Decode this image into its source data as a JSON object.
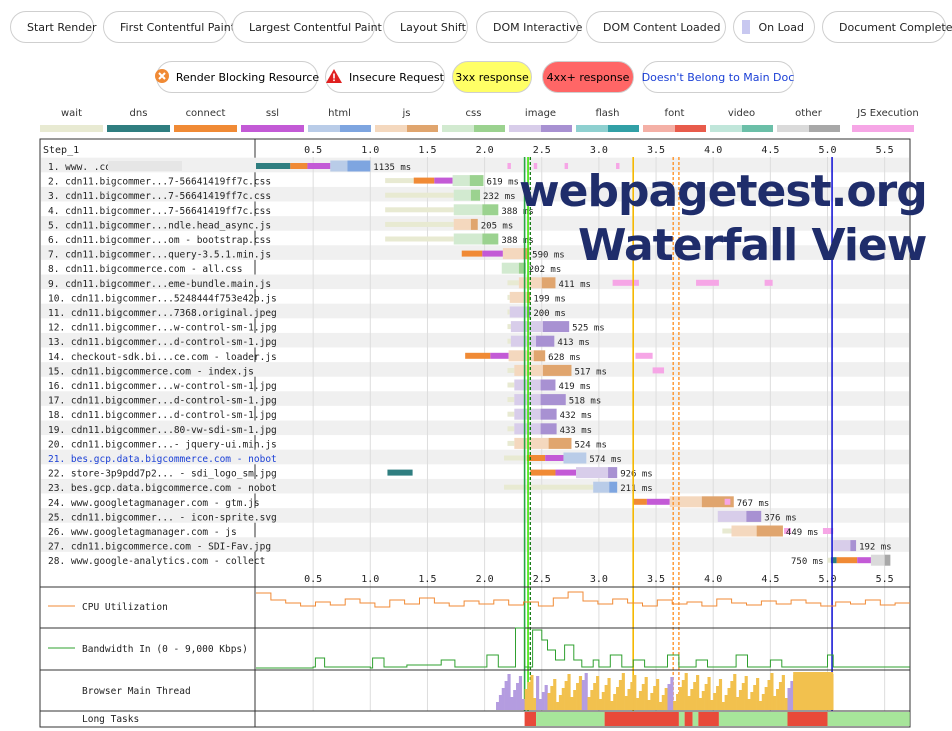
{
  "legend_top": [
    {
      "label": "Start Render",
      "color": "#28a745",
      "style": "solid"
    },
    {
      "label": "First Contentful Paint",
      "color": "#39e600",
      "style": "solid"
    },
    {
      "label": "Largest Contentful Paint",
      "color": "#147a14",
      "style": "dashed"
    },
    {
      "label": "Layout Shift",
      "color": "#ff8c1a",
      "style": "dashed"
    },
    {
      "label": "DOM Interactive",
      "color": "#f5b800",
      "style": "solid"
    },
    {
      "label": "DOM Content Loaded",
      "color": "#d98be0",
      "style": "box"
    },
    {
      "label": "On Load",
      "color": "#c8c8f0",
      "style": "box"
    },
    {
      "label": "Document Complete",
      "color": "#1a1ad6",
      "style": "solid"
    }
  ],
  "legend_bottom": [
    {
      "label": "Render Blocking Resource",
      "kind": "blocking"
    },
    {
      "label": "Insecure Request",
      "kind": "insecure"
    },
    {
      "label": "3xx response",
      "kind": "3xx",
      "bg": "#ffff66"
    },
    {
      "label": "4xx+ response",
      "kind": "4xx",
      "bg": "#ff6666"
    },
    {
      "label": "Doesn't Belong to Main Doc",
      "kind": "foreign",
      "color": "#1a3fd6"
    }
  ],
  "connection_types": [
    {
      "label": "wait",
      "colors": [
        "#e8ead2"
      ]
    },
    {
      "label": "dns",
      "colors": [
        "#2f7e80"
      ]
    },
    {
      "label": "connect",
      "colors": [
        "#f08a35"
      ]
    },
    {
      "label": "ssl",
      "colors": [
        "#c35ad6"
      ]
    },
    {
      "label": "html",
      "colors": [
        "#b9cce8",
        "#7ea5e0"
      ]
    },
    {
      "label": "js",
      "colors": [
        "#f4d8be",
        "#e0a56e"
      ]
    },
    {
      "label": "css",
      "colors": [
        "#d2ead0",
        "#9bd28f"
      ]
    },
    {
      "label": "image",
      "colors": [
        "#d8cdea",
        "#a891d2"
      ]
    },
    {
      "label": "flash",
      "colors": [
        "#8ed0d0",
        "#31a0a6"
      ]
    },
    {
      "label": "font",
      "colors": [
        "#f4b0a6",
        "#e85b4b"
      ]
    },
    {
      "label": "video",
      "colors": [
        "#c0e6da",
        "#6bbfa8"
      ]
    },
    {
      "label": "other",
      "colors": [
        "#dadada",
        "#a8a8a8"
      ]
    },
    {
      "label": "JS Execution",
      "colors": [
        "#f6a6e6"
      ]
    }
  ],
  "overlay": {
    "line1": "webpagetest.org",
    "line2": "Waterfall View"
  },
  "chart_data": {
    "type": "waterfall",
    "step_label": "Step_1",
    "x_unit": "seconds",
    "xlim": [
      0,
      5.7
    ],
    "x_ticks": [
      0.5,
      1.0,
      1.5,
      2.0,
      2.5,
      3.0,
      3.5,
      4.0,
      4.5,
      5.0,
      5.5
    ],
    "x_tick_labels": [
      "0.5",
      "1.0",
      "1.5",
      "2.0",
      "2.5",
      "3.0",
      "3.5",
      "4.0",
      "4.5",
      "5.0",
      "5.5"
    ],
    "events": [
      {
        "name": "Start Render",
        "t": 2.35,
        "color": "#28a745"
      },
      {
        "name": "First Contentful Paint",
        "t": 2.38,
        "color": "#39e600"
      },
      {
        "name": "Largest Contentful Paint",
        "t": 2.4,
        "color": "#147a14",
        "dashed": true
      },
      {
        "name": "DOM Interactive",
        "t": 3.3,
        "color": "#f5b800"
      },
      {
        "name": "Layout Shift",
        "t": 3.65,
        "color": "#ff8c1a",
        "dashed": true
      },
      {
        "name": "Layout Shift",
        "t": 3.7,
        "color": "#ff8c1a",
        "dashed": true
      },
      {
        "name": "Document Complete",
        "t": 5.04,
        "color": "#1a1ad6"
      }
    ],
    "requests": [
      {
        "n": 1,
        "label": "1. www.                    .com - /",
        "type": "html",
        "start": 0,
        "wait": 0,
        "dns": 0.3,
        "connect": 0.15,
        "ssl": 0.2,
        "ttfb": 0.15,
        "download": 0.2,
        "ms": "1135 ms",
        "redact": true
      },
      {
        "n": 2,
        "label": "2. cdn11.bigcommer...7-56641419ff7c.css",
        "type": "css",
        "start": 1.13,
        "wait": 0.25,
        "dns": 0,
        "connect": 0.18,
        "ssl": 0.16,
        "ttfb": 0.15,
        "download": 0.12,
        "ms": "619 ms"
      },
      {
        "n": 3,
        "label": "3. cdn11.bigcommer...7-56641419ff7c.css",
        "type": "css",
        "start": 1.13,
        "wait": 0.6,
        "ttfb": 0.15,
        "download": 0.08,
        "ms": "232 ms"
      },
      {
        "n": 4,
        "label": "4. cdn11.bigcommer...7-56641419ff7c.css",
        "type": "css",
        "start": 1.13,
        "wait": 0.6,
        "ttfb": 0.25,
        "download": 0.14,
        "ms": "388 ms"
      },
      {
        "n": 5,
        "label": "5. cdn11.bigcommer...ndle.head_async.js",
        "type": "js",
        "start": 1.13,
        "wait": 0.6,
        "ttfb": 0.15,
        "download": 0.06,
        "ms": "205 ms"
      },
      {
        "n": 6,
        "label": "6. cdn11.bigcommer...om - bootstrap.css",
        "type": "css",
        "start": 1.13,
        "wait": 0.6,
        "ttfb": 0.25,
        "download": 0.14,
        "ms": "388 ms"
      },
      {
        "n": 7,
        "label": "7. cdn11.bigcommer...query-3.5.1.min.js",
        "type": "js",
        "start": 1.35,
        "wait": 0,
        "connect": 0.18,
        "ssl": 0.18,
        "gap": 0.45,
        "ttfb": 0.18,
        "download": 0.05,
        "ms": "590 ms",
        "dl_mark": 2.37
      },
      {
        "n": 8,
        "label": "8. cdn11.bigcommerce.com - all.css",
        "type": "css",
        "start": 2.15,
        "wait": 0,
        "ttfb": 0.15,
        "download": 0.06,
        "ms": "202 ms"
      },
      {
        "n": 9,
        "label": "9. cdn11.bigcommer...eme-bundle.main.js",
        "type": "js",
        "start": 2.2,
        "wait": 0.1,
        "ttfb": 0.2,
        "download": 0.12,
        "ms": "411 ms",
        "exec": [
          [
            3.12,
            3.35
          ],
          [
            3.85,
            4.05
          ],
          [
            4.45,
            4.52
          ]
        ]
      },
      {
        "n": 10,
        "label": "10. cdn11.bigcommer...5248444f753e42b.js",
        "type": "js",
        "start": 2.2,
        "wait": 0.02,
        "ttfb": 0.15,
        "download": 0.03,
        "ms": "199 ms"
      },
      {
        "n": 11,
        "label": "11. cdn11.bigcommer...7368.original.jpeg",
        "type": "image",
        "start": 2.2,
        "wait": 0.02,
        "ttfb": 0.15,
        "download": 0.03,
        "ms": "200 ms"
      },
      {
        "n": 12,
        "label": "12. cdn11.bigcommer...w-control-sm-1.jpg",
        "type": "image",
        "start": 2.2,
        "wait": 0.03,
        "ttfb": 0.28,
        "download": 0.23,
        "ms": "525 ms"
      },
      {
        "n": 13,
        "label": "13. cdn11.bigcommer...d-control-sm-1.jpg",
        "type": "image",
        "start": 2.2,
        "wait": 0.03,
        "ttfb": 0.22,
        "download": 0.16,
        "ms": "413 ms"
      },
      {
        "n": 14,
        "label": "14. checkout-sdk.bi...ce.com - loader.js",
        "type": "js",
        "start": 1.55,
        "wait": 0,
        "connect": 0.22,
        "ssl": 0.16,
        "gap": 0.28,
        "ttfb": 0.22,
        "download": 0.1,
        "ms": "628 ms",
        "exec": [
          [
            3.32,
            3.47
          ]
        ]
      },
      {
        "n": 15,
        "label": "15. cdn11.bigcommerce.com - index.js",
        "type": "js",
        "start": 2.2,
        "wait": 0.06,
        "ttfb": 0.25,
        "download": 0.25,
        "ms": "517 ms",
        "exec": [
          [
            3.47,
            3.57
          ]
        ]
      },
      {
        "n": 16,
        "label": "16. cdn11.bigcommer...w-control-sm-1.jpg",
        "type": "image",
        "start": 2.2,
        "wait": 0.06,
        "ttfb": 0.23,
        "download": 0.13,
        "ms": "419 ms"
      },
      {
        "n": 17,
        "label": "17. cdn11.bigcommer...d-control-sm-1.jpg",
        "type": "image",
        "start": 2.2,
        "wait": 0.06,
        "ttfb": 0.23,
        "download": 0.22,
        "ms": "518 ms"
      },
      {
        "n": 18,
        "label": "18. cdn11.bigcommer...d-control-sm-1.jpg",
        "type": "image",
        "start": 2.2,
        "wait": 0.06,
        "ttfb": 0.23,
        "download": 0.14,
        "ms": "432 ms"
      },
      {
        "n": 19,
        "label": "19. cdn11.bigcommer...80-vw-sdi-sm-1.jpg",
        "type": "image",
        "start": 2.2,
        "wait": 0.06,
        "ttfb": 0.23,
        "download": 0.14,
        "ms": "433 ms"
      },
      {
        "n": 20,
        "label": "20. cdn11.bigcommer...- jquery-ui.min.js",
        "type": "js",
        "start": 2.2,
        "wait": 0.06,
        "ttfb": 0.3,
        "download": 0.2,
        "ms": "524 ms"
      },
      {
        "n": 21,
        "label": "21. bes.gcp.data.bigcommerce.com - nobot",
        "type": "html",
        "start": 2.17,
        "wait": 0.2,
        "connect": 0.16,
        "ssl": 0.16,
        "ttfb": 0.2,
        "download": 0,
        "ms": "574 ms",
        "foreign": true
      },
      {
        "n": 22,
        "label": "22. store-3p9pdd7p2... - sdi_logo_sm.jpg",
        "type": "image",
        "start": 1.15,
        "wait": 0,
        "dns": 0.22,
        "gap": 1.03,
        "connect": 0.22,
        "ssl": 0.18,
        "ttfb": 0.28,
        "download": 0.08,
        "ms": "926 ms"
      },
      {
        "n": 23,
        "label": "23. bes.gcp.data.bigcommerce.com - nobot",
        "type": "html",
        "start": 2.17,
        "wait": 0.78,
        "ttfb": 0.14,
        "download": 0.07,
        "ms": "211 ms"
      },
      {
        "n": 24,
        "label": "24. www.googletagmanager.com - gtm.js",
        "type": "js",
        "start": 3.3,
        "wait": 0,
        "connect": 0.12,
        "ssl": 0.2,
        "ttfb": 0.28,
        "download": 0.28,
        "ms": "767 ms",
        "exec": [
          [
            4.1,
            4.15
          ]
        ]
      },
      {
        "n": 25,
        "label": "25. cdn11.bigcommer... - icon-sprite.svg",
        "type": "image",
        "start": 4.04,
        "wait": 0,
        "ttfb": 0.25,
        "download": 0.13,
        "ms": "376 ms"
      },
      {
        "n": 26,
        "label": "26. www.googletagmanager.com - js",
        "type": "js",
        "start": 4.08,
        "wait": 0.08,
        "ttfb": 0.22,
        "download": 0.23,
        "ms": "449 ms",
        "exec": [
          [
            4.62,
            4.68
          ],
          [
            4.96,
            5.05
          ]
        ]
      },
      {
        "n": 27,
        "label": "27. cdn11.bigcommerce.com - SDI-Fav.jpg",
        "type": "image",
        "start": 5.05,
        "wait": 0,
        "ttfb": 0.15,
        "download": 0.05,
        "ms": "192 ms"
      },
      {
        "n": 28,
        "label": "28. www.google-analytics.com - collect",
        "type": "other",
        "start": 5.0,
        "wait": 0.03,
        "dns": 0.05,
        "connect": 0.18,
        "ssl": 0.12,
        "ttfb": 0.12,
        "download": 0.05,
        "ms": "750 ms",
        "ms_left": true
      }
    ],
    "panels": [
      {
        "name": "CPU Utilization",
        "color": "#f08a35"
      },
      {
        "name": "Bandwidth In (0 - 9,000 Kbps)",
        "color": "#2fa02f"
      },
      {
        "name": "Browser Main Thread"
      },
      {
        "name": "Long Tasks"
      }
    ],
    "long_tasks": [
      [
        2.35,
        2.45,
        "#e84a3a"
      ],
      [
        2.45,
        3.05,
        "#a7e59a"
      ],
      [
        3.05,
        3.7,
        "#e84a3a"
      ],
      [
        3.7,
        3.75,
        "#a7e59a"
      ],
      [
        3.75,
        3.82,
        "#e84a3a"
      ],
      [
        3.82,
        3.87,
        "#a7e59a"
      ],
      [
        3.87,
        4.05,
        "#e84a3a"
      ],
      [
        4.05,
        4.65,
        "#a7e59a"
      ],
      [
        4.65,
        5.0,
        "#e84a3a"
      ],
      [
        5.0,
        5.72,
        "#a7e59a"
      ]
    ]
  }
}
